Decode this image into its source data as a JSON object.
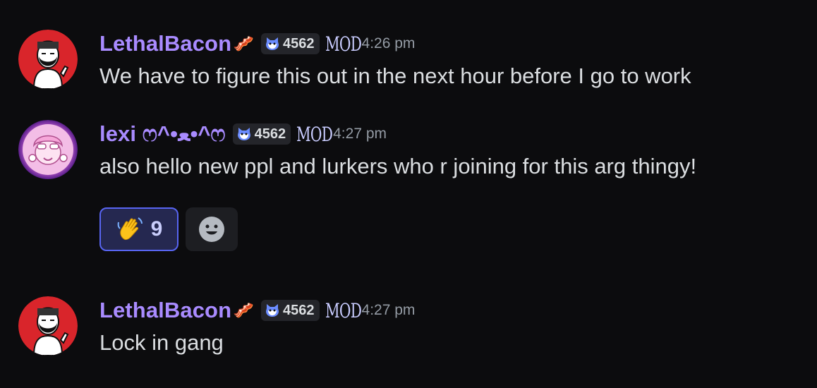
{
  "messages": [
    {
      "username": "LethalBacon",
      "name_emoji": "🥓",
      "tag": "4562",
      "role": "MOD",
      "timestamp": "4:26 pm",
      "content": "We have to figure this out in the next hour before I go to work",
      "avatar": "bearded-man-avatar-red"
    },
    {
      "username": "lexi ෆ^•ﻌ•^ෆ",
      "tag": "4562",
      "role": "MOD",
      "timestamp": "4:27 pm",
      "content": "also hello new ppl and lurkers who r joining for this arg thingy!",
      "avatar": "pink-anime-avatar",
      "reactions": [
        {
          "emoji": "waving-hand-icon",
          "count": "9",
          "active": true
        }
      ],
      "add_reaction_icon": "smiley-icon"
    },
    {
      "username": "LethalBacon",
      "name_emoji": "🥓",
      "tag": "4562",
      "role": "MOD",
      "timestamp": "4:27 pm",
      "content": "Lock in gang",
      "avatar": "bearded-man-avatar-red"
    }
  ],
  "colors": {
    "background": "#0c0c0e",
    "username": "#a98bff",
    "text": "#dbdee1",
    "timestamp": "#949ba4",
    "reaction_active_bg": "#252850",
    "reaction_active_border": "#5865f2"
  }
}
